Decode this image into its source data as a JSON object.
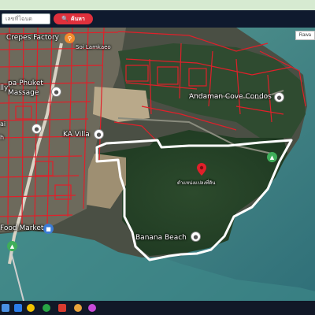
{
  "search": {
    "placeholder": "เลขที่โฉนด",
    "button_label": "ค้นหา"
  },
  "map": {
    "map_type_label": "Rawa",
    "labels": {
      "crepes_factory": "Crepes Factory",
      "sor_lam": "Soi Lamkaeo",
      "lly": "lly",
      "pa_phuket": "pa Phuket",
      "massage": "Massage",
      "ka_villa": "KA Villa",
      "andaman_cove": "Andaman Cove Condos",
      "land_label": "ตำแหน่งแปลงที่ดิน",
      "banana_beach": "Banana Beach",
      "food_market": "Food Market",
      "misc_left_1": "ai",
      "misc_left_2": "h"
    }
  },
  "colors": {
    "parcel_lines": "#e0202a",
    "boundary": "#ffffff",
    "search_button": "#e0303c",
    "toolbar_bg": "#0f1a2e",
    "top_strip": "#d6ead1"
  },
  "icons": {
    "search_button": "search-icon",
    "land_marker": "map-pin-icon",
    "place_pins": "place-pin-icon",
    "restaurant_pin": "fork-knife-icon",
    "shopping_pin": "shopping-bag-icon",
    "park_pins": "tree-icon"
  }
}
